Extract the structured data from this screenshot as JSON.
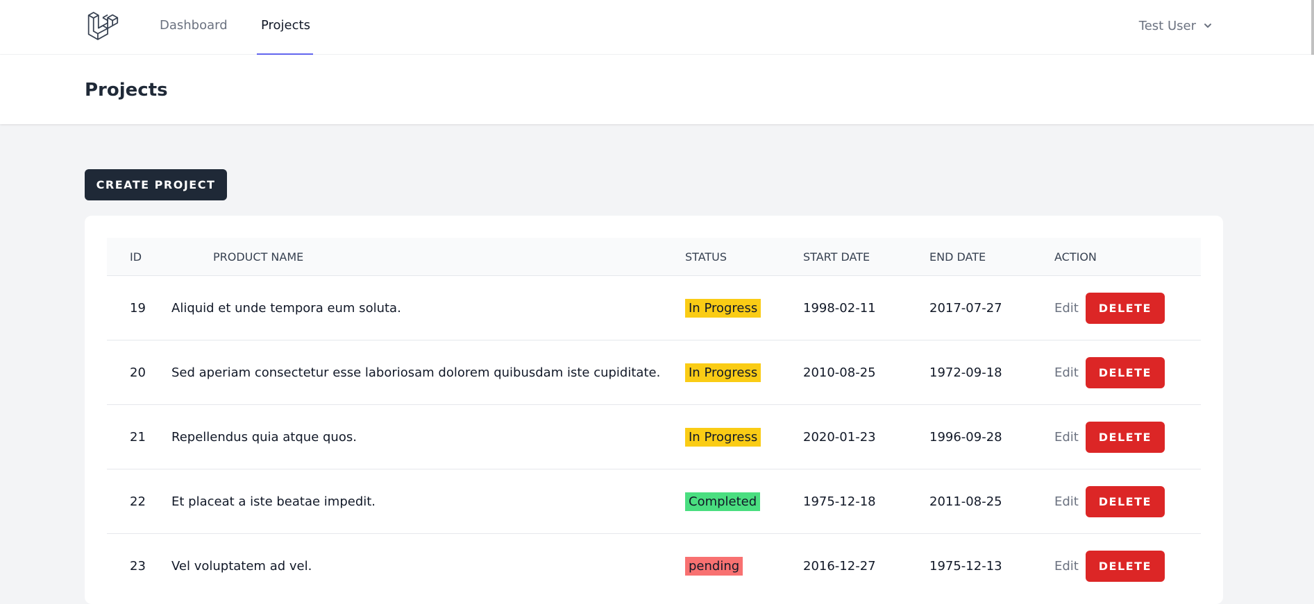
{
  "nav": {
    "links": [
      {
        "label": "Dashboard"
      },
      {
        "label": "Projects"
      }
    ],
    "user": {
      "name": "Test User"
    },
    "logo_icon": "laravel-logo-icon"
  },
  "header": {
    "title": "Projects"
  },
  "actions": {
    "create_label": "CREATE PROJECT"
  },
  "table": {
    "columns": [
      "ID",
      "PRODUCT NAME",
      "STATUS",
      "START DATE",
      "END DATE",
      "ACTION"
    ],
    "rows": [
      {
        "id": "19",
        "name": "Aliquid et unde tempora eum soluta.",
        "status": "In Progress",
        "status_color": "#facc15",
        "start": "1998-02-11",
        "end": "2017-07-27",
        "edit": "Edit",
        "delete": "DELETE"
      },
      {
        "id": "20",
        "name": "Sed aperiam consectetur esse laboriosam dolorem quibusdam iste cupiditate.",
        "status": "In Progress",
        "status_color": "#facc15",
        "start": "2010-08-25",
        "end": "1972-09-18",
        "edit": "Edit",
        "delete": "DELETE"
      },
      {
        "id": "21",
        "name": "Repellendus quia atque quos.",
        "status": "In Progress",
        "status_color": "#facc15",
        "start": "2020-01-23",
        "end": "1996-09-28",
        "edit": "Edit",
        "delete": "DELETE"
      },
      {
        "id": "22",
        "name": "Et placeat a iste beatae impedit.",
        "status": "Completed",
        "status_color": "#4ade80",
        "start": "1975-12-18",
        "end": "2011-08-25",
        "edit": "Edit",
        "delete": "DELETE"
      },
      {
        "id": "23",
        "name": "Vel voluptatem ad vel.",
        "status": "pending",
        "status_color": "#f87171",
        "start": "2016-12-27",
        "end": "1975-12-13",
        "edit": "Edit",
        "delete": "DELETE"
      }
    ]
  },
  "colors": {
    "primary_dark": "#1f2937",
    "danger": "#dc2626",
    "accent": "#6366f1"
  }
}
